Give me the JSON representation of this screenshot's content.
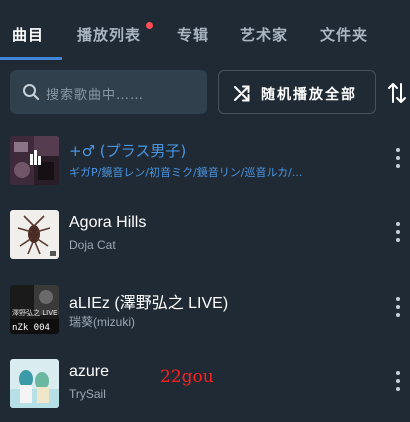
{
  "tabs": [
    {
      "label": "曲目",
      "active": true
    },
    {
      "label": "播放列表",
      "active": false,
      "has_badge": true
    },
    {
      "label": "专辑",
      "active": false
    },
    {
      "label": "艺术家",
      "active": false
    },
    {
      "label": "文件夹",
      "active": false
    }
  ],
  "search": {
    "placeholder": "搜索歌曲中……",
    "icon": "search-icon"
  },
  "shuffle": {
    "label": "随机播放全部",
    "icon": "shuffle-icon"
  },
  "sort": {
    "icon": "sort-icon"
  },
  "songs": [
    {
      "title": "+♂ (プラス男子)",
      "artist": "ギガP/鏡音レン/初音ミク/鏡音リン/巡音ルカ/...",
      "playing": true
    },
    {
      "title": "Agora Hills",
      "artist": "Doja Cat",
      "playing": false
    },
    {
      "title": "aLIEz (澤野弘之 LIVE)",
      "artist": "瑞葵(mizuki)",
      "playing": false
    },
    {
      "title": "azure",
      "artist": "TrySail",
      "playing": false
    }
  ],
  "covers": {
    "cover3_text_top": "澤野弘之 LIVE",
    "cover3_text_bottom": "nZk 004"
  },
  "watermark": "22gou",
  "colors": {
    "background": "#1f2a34",
    "accent": "#3f86d8",
    "highlight_text": "#4b95e3",
    "badge": "#ff4d57",
    "watermark": "#ff2020"
  }
}
